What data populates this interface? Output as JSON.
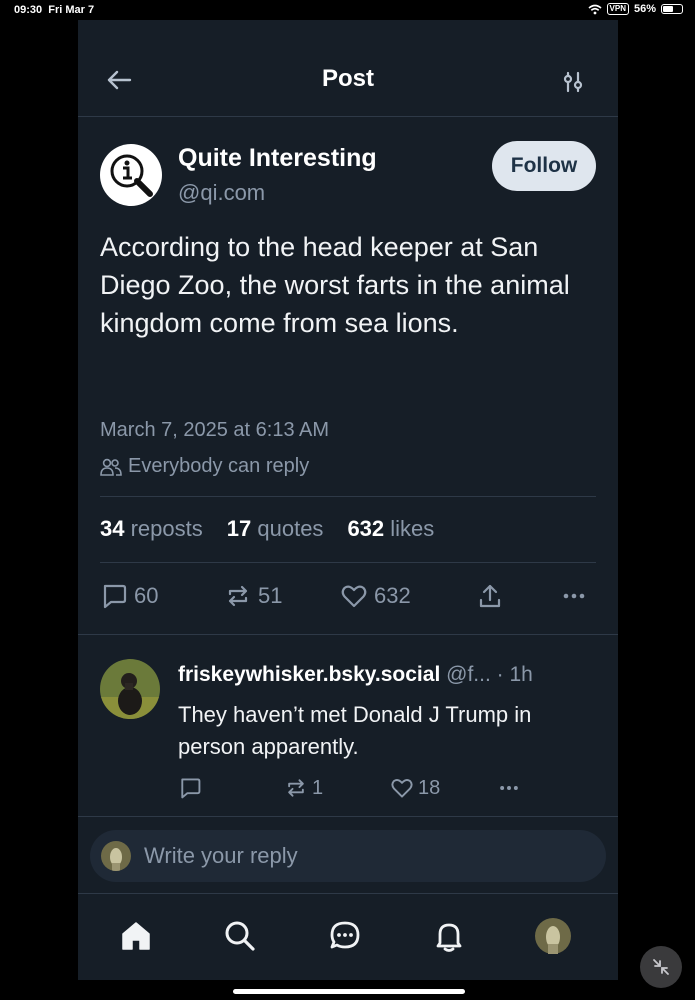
{
  "status_bar": {
    "time": "09:30",
    "date": "Fri Mar 7",
    "vpn": "VPN",
    "battery": "56%",
    "battery_level": 0.56
  },
  "header": {
    "title": "Post",
    "back_icon": "arrow-left-icon",
    "filter_icon": "sliders-icon"
  },
  "post": {
    "author_name": "Quite Interesting",
    "author_handle": "@qi.com",
    "follow_label": "Follow",
    "text": "According to the head keeper at San Diego Zoo, the worst farts in the animal kingdom come from sea lions.",
    "timestamp": "March 7, 2025 at 6:13 AM",
    "reply_setting": "Everybody can reply",
    "stats": {
      "reposts_count": "34",
      "reposts_label": "reposts",
      "quotes_count": "17",
      "quotes_label": "quotes",
      "likes_count": "632",
      "likes_label": "likes"
    },
    "actions": {
      "replies": "60",
      "reposts": "51",
      "likes": "632"
    }
  },
  "reply": {
    "author_name": "friskeywhisker.bsky.social",
    "handle_truncated": "@f...",
    "time": "· 1h",
    "text": "They haven’t met Donald J Trump in person apparently.",
    "reposts": "1",
    "likes": "18"
  },
  "composer": {
    "placeholder": "Write your reply"
  },
  "colors": {
    "background": "#161e27",
    "accent_text": "#8b98a9",
    "follow_bg": "#dfe6ee",
    "divider": "#2e3947"
  }
}
